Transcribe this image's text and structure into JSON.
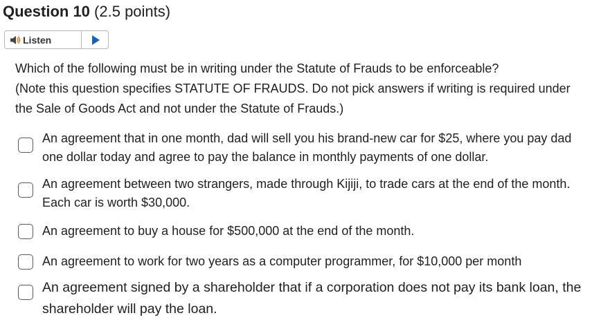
{
  "question": {
    "title": "Question 10",
    "points": "(2.5 points)"
  },
  "listen": {
    "label": "Listen",
    "speaker_icon": "speaker-icon",
    "play_icon": "play-icon",
    "accent_color": "#1060c9"
  },
  "prompt": {
    "line1": "Which of the following must be in writing under the Statute of Frauds to be enforceable?",
    "line2": "(Note this question specifies STATUTE OF FRAUDS. Do not pick answers if writing is required under the Sale of Goods Act and not under the Statute of Frauds.)"
  },
  "options": [
    {
      "text": "An agreement that in one month, dad will sell you his brand-new car for $25, where you pay dad one dollar today and agree to pay the balance in monthly payments of one dollar.",
      "checked": false
    },
    {
      "text": "An agreement between two strangers, made through Kijiji, to trade cars at the end of the month. Each car is worth $30,000.",
      "checked": false
    },
    {
      "text": "An agreement to buy a house for $500,000 at the end of the month.",
      "checked": false
    },
    {
      "text": "An agreement to work for two years as a computer programmer, for $10,000 per month",
      "checked": false
    },
    {
      "text": "An agreement signed by a shareholder that if a corporation does not pay its bank loan, the shareholder will pay the loan.",
      "checked": false
    }
  ]
}
